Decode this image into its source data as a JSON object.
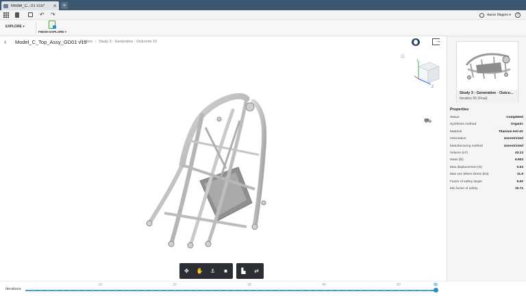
{
  "tabs": {
    "document_title": "Model_C...01 v15*",
    "close_glyph": "✕",
    "new_tab_glyph": "+"
  },
  "quick_access": {
    "undo_glyph": "↶",
    "redo_glyph": "↷",
    "user_name": "Aaron Magnin ▾",
    "help_glyph": "?"
  },
  "toolbar": {
    "workspace": "EXPLORE ▾",
    "finish_label": "FINISH EXPLORE ▾"
  },
  "header": {
    "back_glyph": "‹",
    "model_name": "Model_C_Top_Assy_GD01 v15",
    "breadcrumbs": [
      "›",
      "Explore",
      "›",
      "Study 3 - Generative - Outcome 10"
    ]
  },
  "viewport": {
    "home_glyph": "⌂",
    "viewcube_axes": {
      "y": "Y",
      "z": "Z"
    }
  },
  "navbar": {
    "orbit_glyph": "✥",
    "pan_glyph": "✋",
    "zoom_glyph": "⚓",
    "look_glyph": "■",
    "display_glyph": "▙",
    "swap_glyph": "⇄"
  },
  "panel": {
    "card_title": "Study 3 - Generative - Outco...",
    "card_subtitle": "Iteration 55 (Final)",
    "properties_title": "Properties",
    "properties": [
      {
        "label": "Status",
        "value": "Completed"
      },
      {
        "label": "Synthesis method",
        "value": "Organic"
      },
      {
        "label": "Material",
        "value": "Titanium 6Al-4V"
      },
      {
        "label": "Orientation",
        "value": "Unrestricted"
      },
      {
        "label": "Manufacturing method",
        "value": "Unrestricted"
      },
      {
        "label": "Volume (in³)",
        "value": "43.13"
      },
      {
        "label": "Mass (lb)",
        "value": "6.903"
      },
      {
        "label": "Max displacement (in)",
        "value": "0.03"
      },
      {
        "label": "Max von Mises stress (ksi)",
        "value": "11.9"
      },
      {
        "label": "Factor of safety target",
        "value": "9.00"
      },
      {
        "label": "Min factor of safety",
        "value": "10.71"
      }
    ]
  },
  "iterations": {
    "label": "Iterations",
    "ticks": [
      "10",
      "20",
      "30",
      "40",
      "50",
      "55"
    ],
    "current": 55,
    "max": 55
  },
  "colors": {
    "tab_bar": "#3e5770",
    "accent": "#2a8fc7",
    "slider_track": "#3aa1d7",
    "nav_bar": "#2b2f33"
  }
}
